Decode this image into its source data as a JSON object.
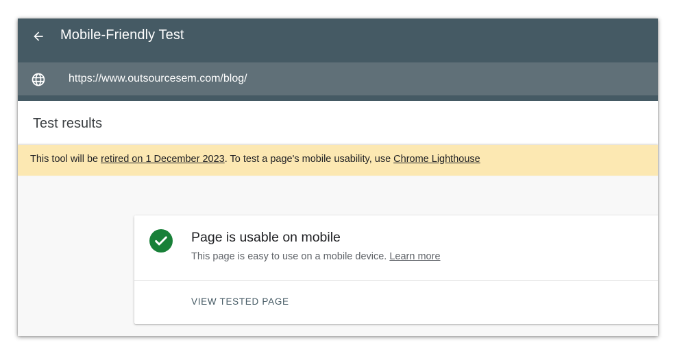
{
  "app": {
    "title": "Mobile-Friendly Test",
    "back_icon": "arrow-back-icon",
    "colors": {
      "appbar": "#455a64",
      "urlbar": "#607078"
    }
  },
  "urlbar": {
    "icon": "globe-icon",
    "url": "https://www.outsourcesem.com/blog/"
  },
  "results": {
    "title": "Test results"
  },
  "notice": {
    "text_before": "This tool will be ",
    "link1": "retired on 1 December 2023",
    "text_middle": ". To test a page's mobile usability, use ",
    "link2": "Chrome Lighthouse",
    "background": "#fce8b2"
  },
  "result_card": {
    "status_icon": "check-circle-icon",
    "status_color": "#188038",
    "title": "Page is usable on mobile",
    "subtitle": "This page is easy to use on a mobile device. ",
    "learn_more": "Learn more",
    "action": "VIEW TESTED PAGE"
  }
}
